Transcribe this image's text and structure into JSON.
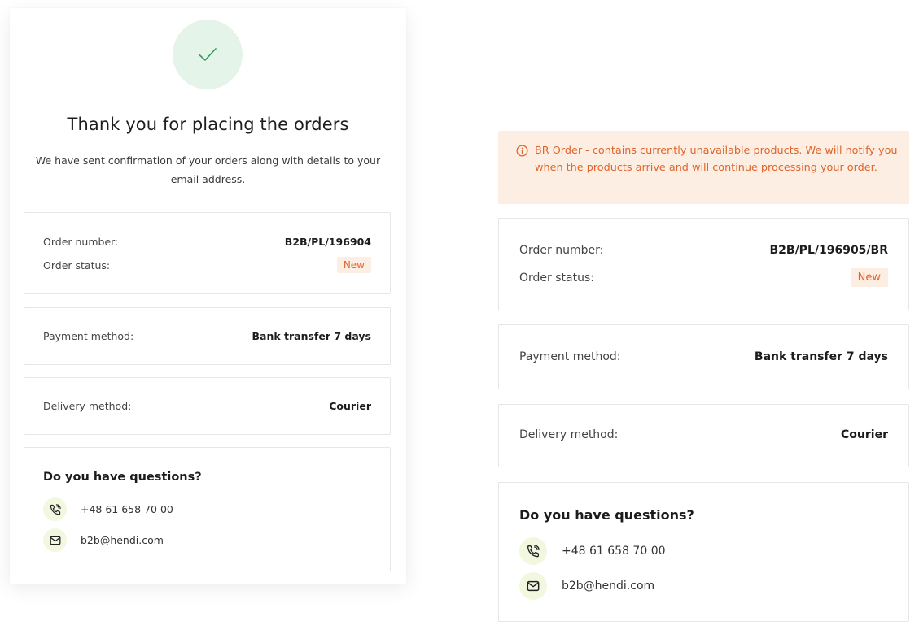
{
  "colors": {
    "accent_orange": "#e0652c",
    "badge_bg": "#fdeee3",
    "success_circle_bg": "#e5f4e9",
    "success_check": "#3a9a5c",
    "contact_icon_bg": "#f2f7e0"
  },
  "left": {
    "success_icon": "check-icon",
    "title": "Thank you for placing the orders",
    "subtitle": "We have sent confirmation of your orders along with details to your email address.",
    "order": {
      "number_label": "Order number:",
      "number_value": "B2B/PL/196904",
      "status_label": "Order status:",
      "status_value": "New"
    },
    "payment": {
      "label": "Payment method:",
      "value": "Bank transfer 7 days"
    },
    "delivery": {
      "label": "Delivery method:",
      "value": "Courier"
    },
    "questions": {
      "title": "Do you have questions?",
      "phone": "+48 61 658 70 00",
      "phone_icon": "phone-icon",
      "email": "b2b@hendi.com",
      "email_icon": "mail-icon"
    }
  },
  "right": {
    "alert": {
      "icon": "info-icon",
      "text": "BR Order - contains currently unavailable products. We will notify you when the products arrive and will continue processing your order."
    },
    "order": {
      "number_label": "Order number:",
      "number_value": "B2B/PL/196905/BR",
      "status_label": "Order status:",
      "status_value": "New"
    },
    "payment": {
      "label": "Payment method:",
      "value": "Bank transfer 7 days"
    },
    "delivery": {
      "label": "Delivery method:",
      "value": "Courier"
    },
    "questions": {
      "title": "Do you have questions?",
      "phone": "+48 61 658 70 00",
      "phone_icon": "phone-icon",
      "email": "b2b@hendi.com",
      "email_icon": "mail-icon"
    }
  }
}
